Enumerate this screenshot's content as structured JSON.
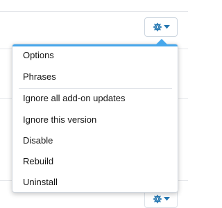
{
  "toolbar": {
    "gear_icon": "gear-icon",
    "caret_icon": "caret-down-icon",
    "accent_color": "#47a7eb"
  },
  "menu": {
    "items": [
      {
        "label": "Options"
      },
      {
        "label": "Phrases"
      },
      {
        "label": "Ignore all add-on updates"
      },
      {
        "label": "Ignore this version"
      },
      {
        "label": "Disable"
      },
      {
        "label": "Rebuild"
      },
      {
        "label": "Uninstall"
      }
    ]
  }
}
